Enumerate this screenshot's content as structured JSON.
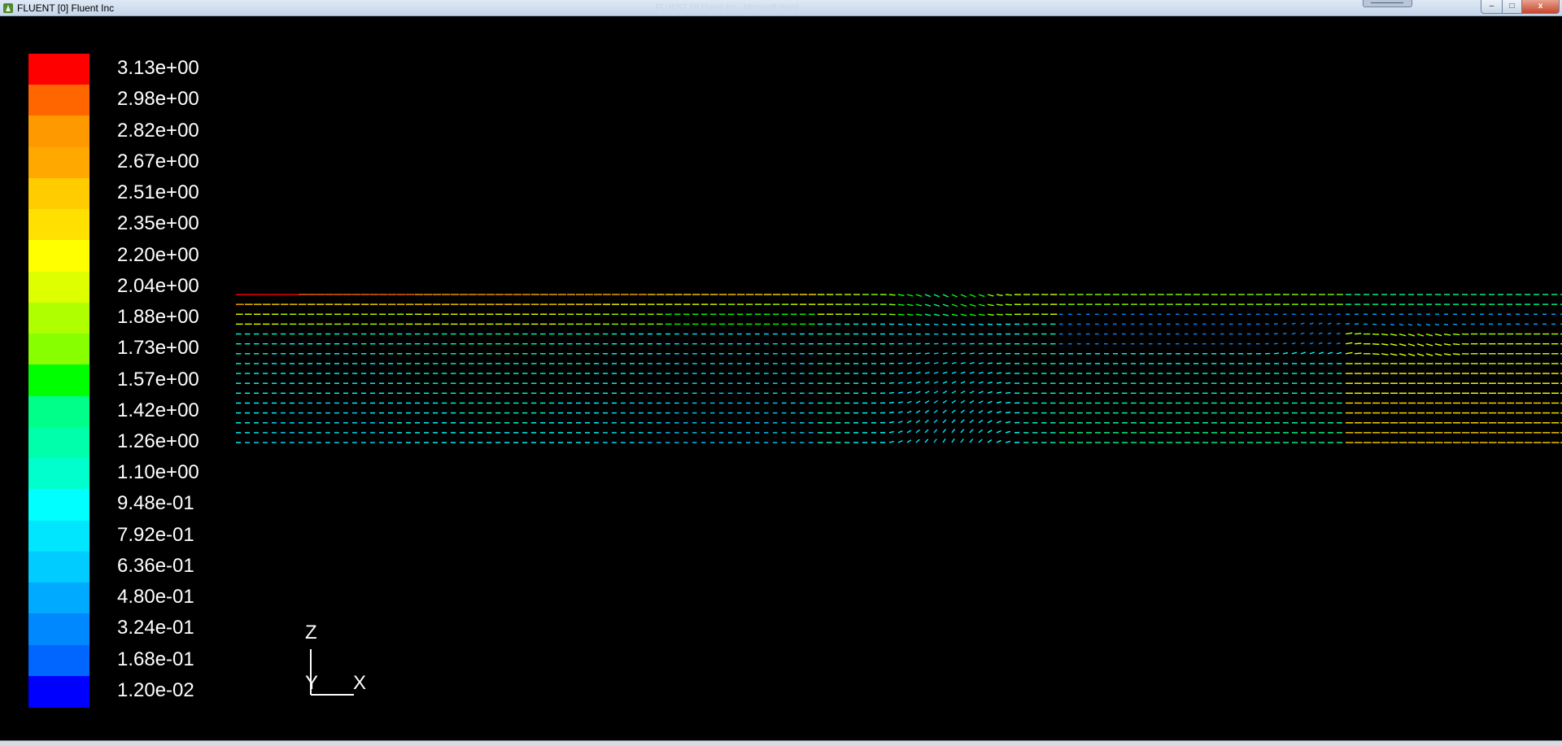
{
  "window": {
    "title": "FLUENT [0] Fluent Inc",
    "faded_title": "FLUENT [0] Fluent Inc - Microsoft Word",
    "controls": {
      "minimize": "–",
      "maximize": "□",
      "close": "x"
    }
  },
  "colormap": {
    "colors": [
      "#ff0000",
      "#ff6600",
      "#ff9900",
      "#ffa800",
      "#ffcc00",
      "#ffe000",
      "#ffff00",
      "#ddff00",
      "#b0ff00",
      "#88ff00",
      "#00ff00",
      "#00ff88",
      "#00ffaa",
      "#00ffcc",
      "#00ffff",
      "#00e6ff",
      "#00ccff",
      "#00aaff",
      "#0088ff",
      "#0066ff",
      "#0000ff"
    ],
    "labels": [
      "3.13e+00",
      "2.98e+00",
      "2.82e+00",
      "2.67e+00",
      "2.51e+00",
      "2.35e+00",
      "2.20e+00",
      "2.04e+00",
      "1.88e+00",
      "1.73e+00",
      "1.57e+00",
      "1.42e+00",
      "1.26e+00",
      "1.10e+00",
      "9.48e-01",
      "7.92e-01",
      "6.36e-01",
      "4.80e-01",
      "3.24e-01",
      "1.68e-01",
      "1.20e-02"
    ],
    "min": 0.012,
    "max": 3.13
  },
  "axes": {
    "z": "Z",
    "y": "Y",
    "x": "X"
  }
}
